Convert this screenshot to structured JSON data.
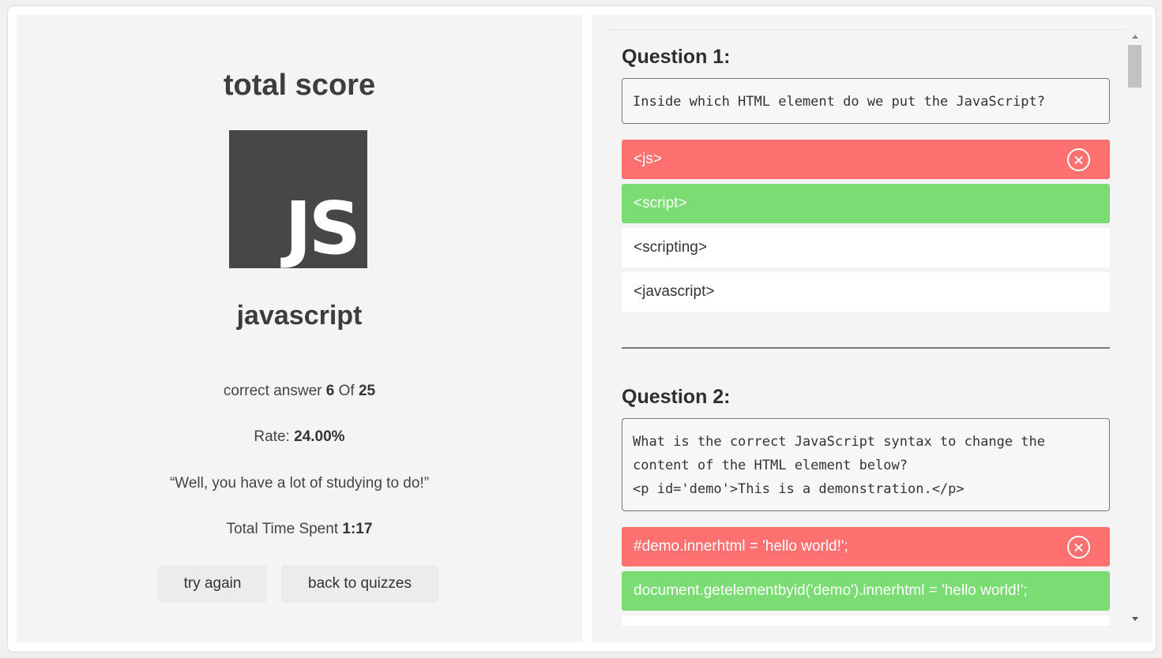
{
  "summary": {
    "title": "total score",
    "logo_text": "JS",
    "quiz_name": "javascript",
    "correct_label": "correct answer",
    "correct_count": "6",
    "of_label": "Of",
    "total_count": "25",
    "rate_label": "Rate:",
    "rate_value": "24.00%",
    "message": "“Well, you have a lot of studying to do!”",
    "time_label": "Total Time Spent",
    "time_value": "1:17",
    "try_again_label": "try again",
    "back_label": "back to quizzes"
  },
  "questions": [
    {
      "title": "Question 1:",
      "text": "Inside which HTML element do we put the JavaScript?",
      "options": [
        {
          "label": "<js>",
          "state": "wrong"
        },
        {
          "label": "<script>",
          "state": "correct"
        },
        {
          "label": "<scripting>",
          "state": "neutral"
        },
        {
          "label": "<javascript>",
          "state": "neutral"
        }
      ]
    },
    {
      "title": "Question 2:",
      "text": "What is the correct JavaScript syntax to change the content of the HTML element below?\n<p id='demo'>This is a demonstration.</p>",
      "options": [
        {
          "label": "#demo.innerhtml = 'hello world!';",
          "state": "wrong"
        },
        {
          "label": "document.getelementbyid('demo').innerhtml = 'hello world!';",
          "state": "correct"
        }
      ]
    }
  ],
  "colors": {
    "wrong": "#ff7070",
    "correct": "#7adc73",
    "logo_bg": "#474747"
  },
  "icons": {
    "wrong_marker": "close-circle-icon"
  }
}
